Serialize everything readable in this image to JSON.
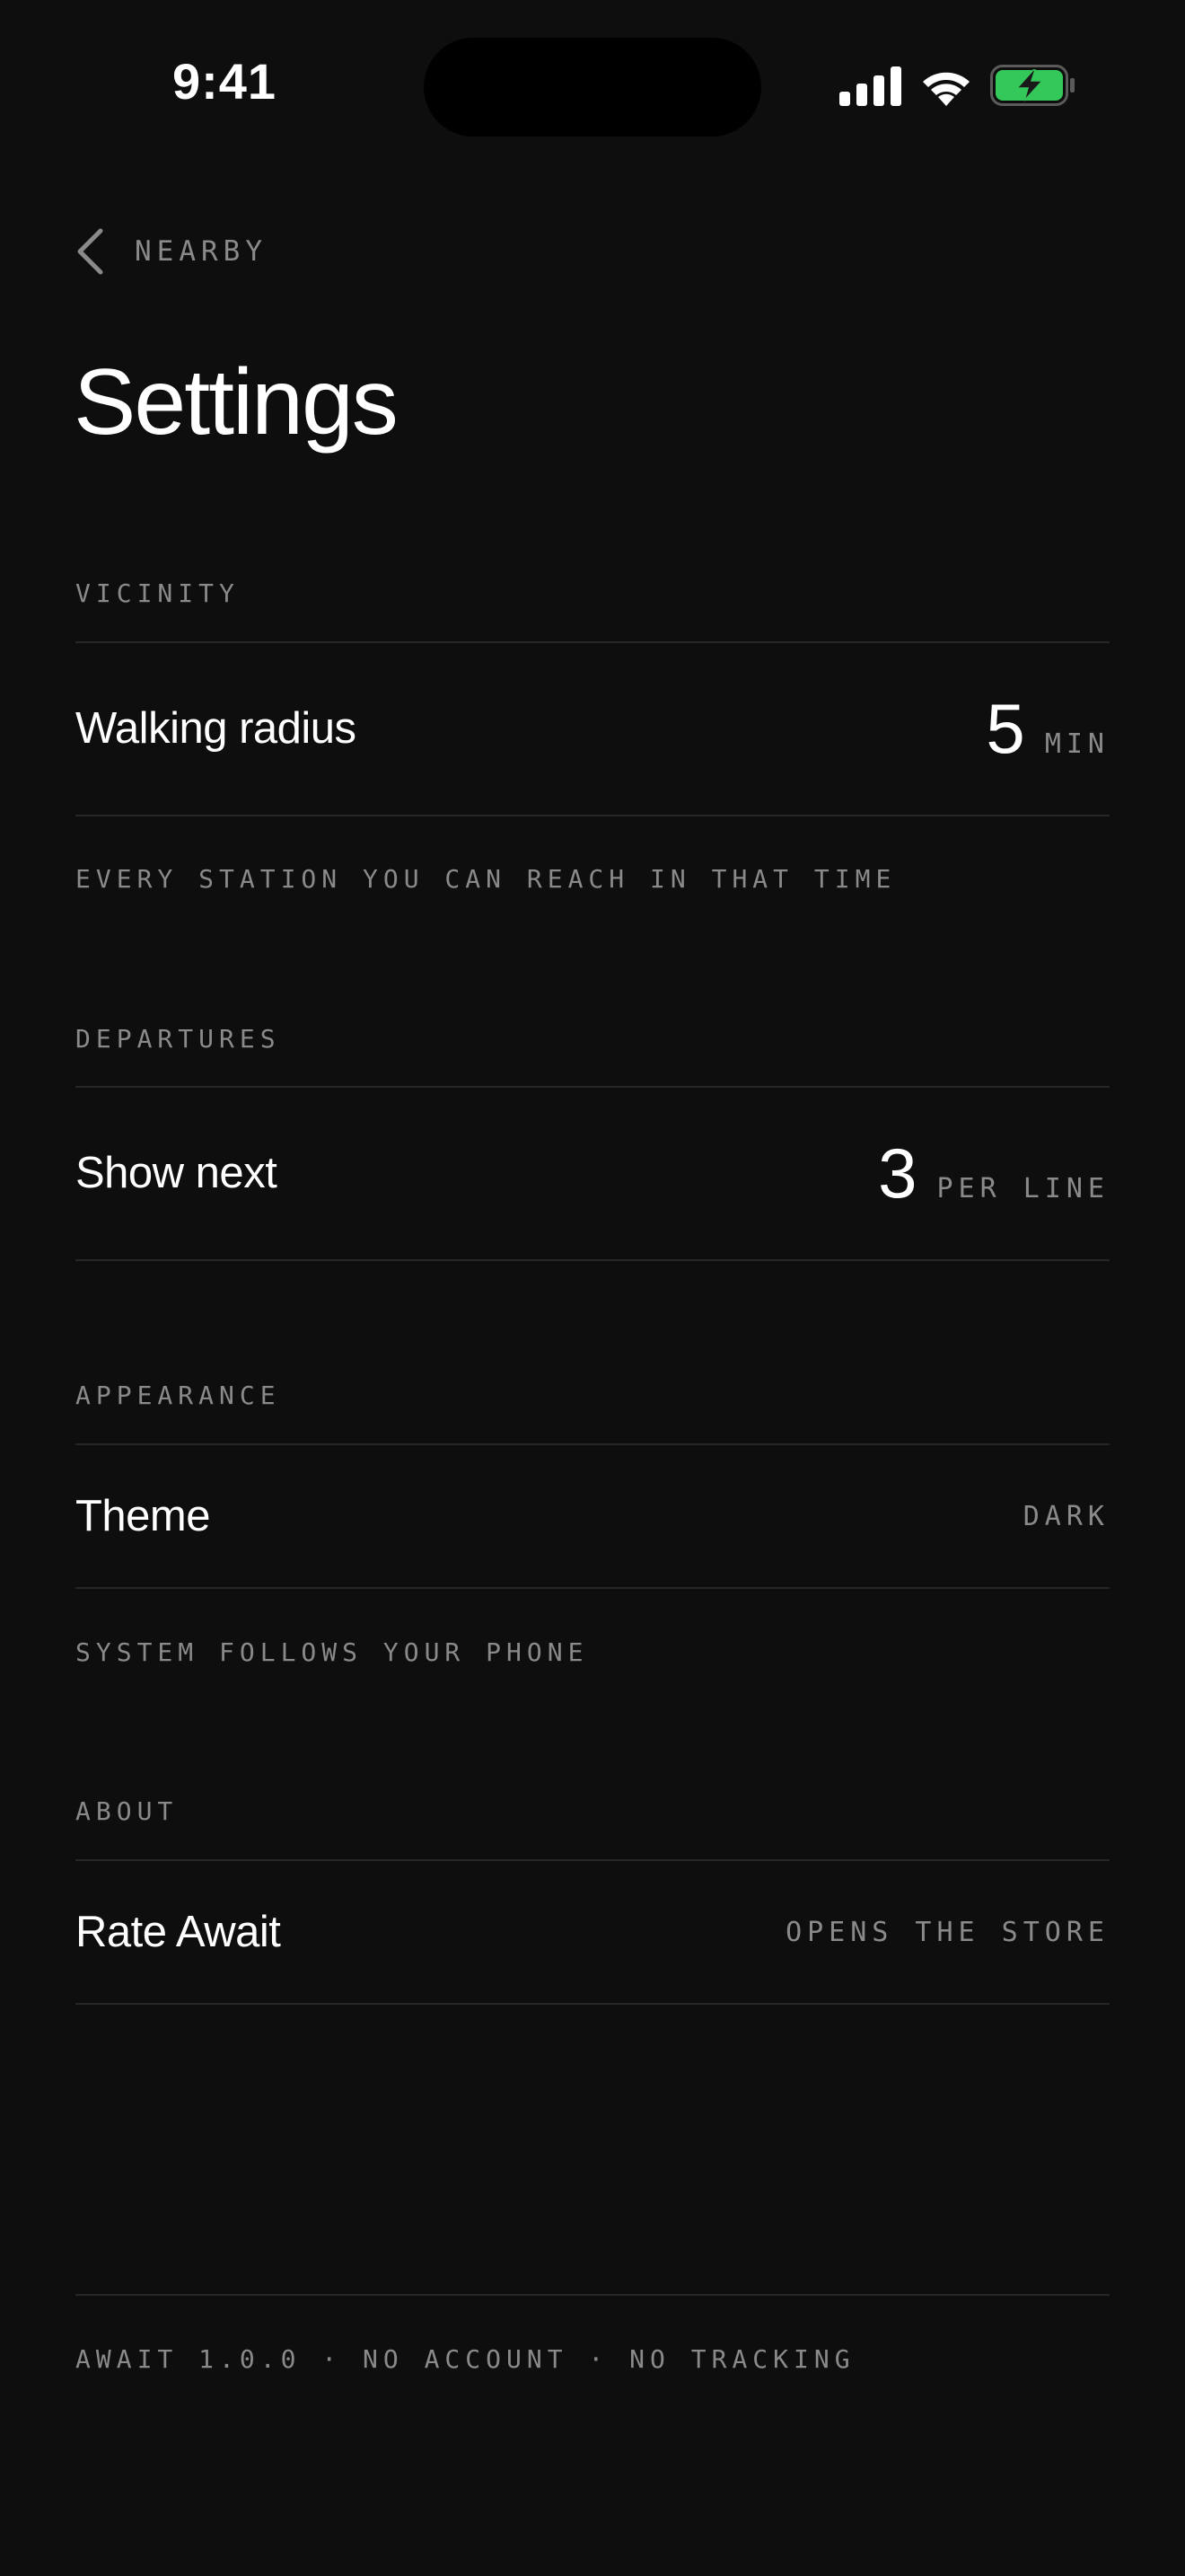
{
  "status_bar": {
    "time": "9:41",
    "battery_color": "#34c759"
  },
  "nav": {
    "back_label": "NEARBY"
  },
  "page": {
    "title": "Settings"
  },
  "sections": {
    "vicinity": {
      "header": "VICINITY",
      "walking_radius": {
        "label": "Walking radius",
        "value": "5",
        "unit": "MIN"
      },
      "footnote": "EVERY STATION YOU CAN REACH IN THAT TIME"
    },
    "departures": {
      "header": "DEPARTURES",
      "show_next": {
        "label": "Show next",
        "value": "3",
        "unit": "PER LINE"
      }
    },
    "appearance": {
      "header": "APPEARANCE",
      "theme": {
        "label": "Theme",
        "value": "DARK"
      },
      "footnote": "SYSTEM FOLLOWS YOUR PHONE"
    },
    "about": {
      "header": "ABOUT",
      "rate": {
        "label": "Rate Await",
        "value": "OPENS THE STORE"
      }
    }
  },
  "footer": {
    "text": "AWAIT 1.0.0 · NO ACCOUNT · NO TRACKING"
  }
}
